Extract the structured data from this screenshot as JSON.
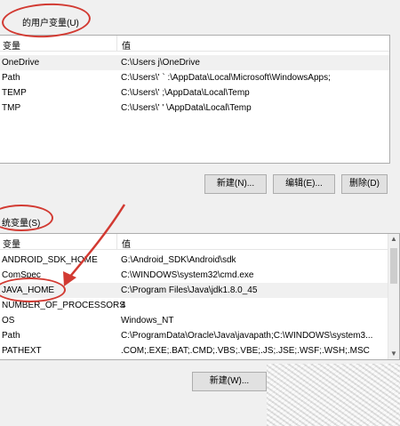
{
  "user_vars": {
    "group_label": "的用户变量(U)",
    "col_var": "变量",
    "col_val": "值",
    "rows": [
      {
        "name": "OneDrive",
        "value": "C:\\Users       j\\OneDrive"
      },
      {
        "name": "Path",
        "value": "C:\\Users\\'      `   :\\AppData\\Local\\Microsoft\\WindowsApps;"
      },
      {
        "name": "TEMP",
        "value": "C:\\Users\\'    ;\\AppData\\Local\\Temp"
      },
      {
        "name": "TMP",
        "value": "C:\\Users\\'      '  \\AppData\\Local\\Temp"
      }
    ],
    "buttons": {
      "new": "新建(N)...",
      "edit": "编辑(E)...",
      "delete": "删除(D)"
    }
  },
  "system_vars": {
    "group_label": "统变量(S)",
    "col_var": "变量",
    "col_val": "值",
    "rows": [
      {
        "name": "ANDROID_SDK_HOME",
        "value": "G:\\Android_SDK\\Android\\sdk"
      },
      {
        "name": "ComSpec",
        "value": "C:\\WINDOWS\\system32\\cmd.exe"
      },
      {
        "name": "JAVA_HOME",
        "value": "C:\\Program Files\\Java\\jdk1.8.0_45"
      },
      {
        "name": "NUMBER_OF_PROCESSORS",
        "value": "4"
      },
      {
        "name": "OS",
        "value": "Windows_NT"
      },
      {
        "name": "Path",
        "value": "C:\\ProgramData\\Oracle\\Java\\javapath;C:\\WINDOWS\\system3..."
      },
      {
        "name": "PATHEXT",
        "value": ".COM;.EXE;.BAT;.CMD;.VBS;.VBE;.JS;.JSE;.WSF;.WSH;.MSC"
      }
    ],
    "buttons": {
      "new": "新建(W)..."
    }
  },
  "annotation_color": "#d23a32"
}
